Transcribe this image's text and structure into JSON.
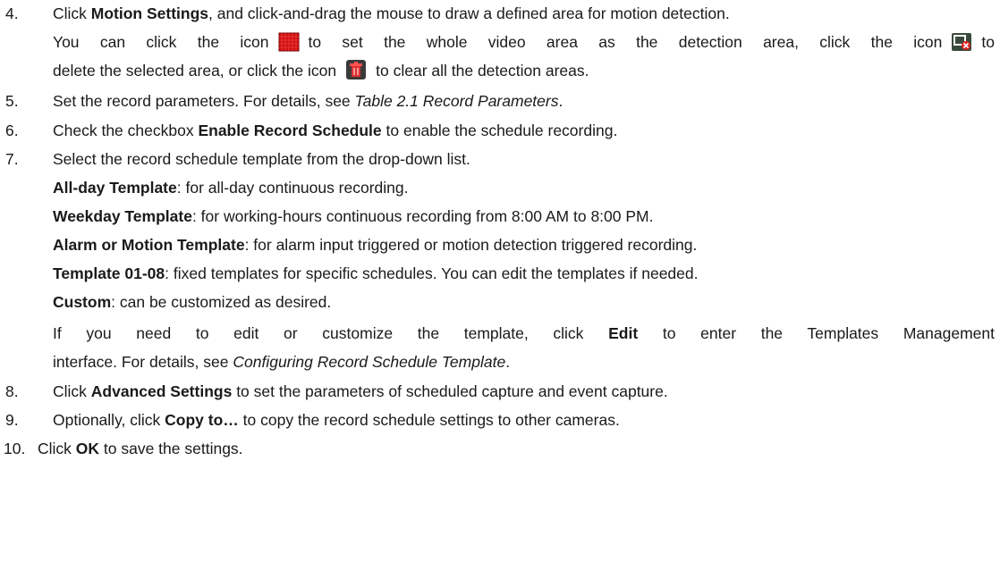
{
  "steps": {
    "s4": {
      "num": "4.",
      "a_pre": "Click ",
      "a_bold": "Motion Settings",
      "a_post": ", and click-and-drag the mouse to draw a defined area for motion detection.",
      "b_1": "You can click the icon",
      "b_2": "to set the whole video area as the detection area, click the icon",
      "b_3": "to",
      "c_1": "delete the selected area, or click the icon",
      "c_2": "to clear all the detection areas."
    },
    "s5": {
      "num": "5.",
      "pre": "Set the record parameters. For details, see ",
      "ital": "Table 2.1 Record Parameters",
      "post": "."
    },
    "s6": {
      "num": "6.",
      "pre": "Check the checkbox ",
      "bold": "Enable Record Schedule",
      "post": " to enable the schedule recording."
    },
    "s7": {
      "num": "7.",
      "intro": "Select the record schedule template from the drop-down list.",
      "options": [
        {
          "name": "All-day Template",
          "desc": ": for all-day continuous recording."
        },
        {
          "name": "Weekday Template",
          "desc": ": for working-hours continuous recording from 8:00 AM to 8:00 PM."
        },
        {
          "name": "Alarm or Motion Template",
          "desc": ": for alarm input triggered or motion detection triggered recording."
        },
        {
          "name": "Template 01-08",
          "desc": ": fixed templates for specific schedules. You can edit the templates if needed."
        },
        {
          "name": "Custom",
          "desc": ": can be customized as desired."
        }
      ],
      "edit_pre": "If you need to edit or customize the template, click",
      "edit_bold": "Edit",
      "edit_post": "to enter the Templates Management",
      "edit2_pre": "interface. For details, see ",
      "edit2_ital": "Configuring Record Schedule Template",
      "edit2_post": "."
    },
    "s8": {
      "num": "8.",
      "pre": "Click ",
      "bold": "Advanced Settings",
      "post": " to set the parameters of scheduled capture and event capture."
    },
    "s9": {
      "num": "9.",
      "pre": "Optionally, click ",
      "bold": "Copy to…",
      "post": " to copy the record schedule settings to other cameras."
    },
    "s10": {
      "num": "10.",
      "pre": "Click ",
      "bold": "OK",
      "post": " to save the settings."
    }
  },
  "icons": [
    "select-all-area-icon",
    "delete-area-icon",
    "clear-all-areas-icon"
  ],
  "colors": {
    "text": "#1a1a1a",
    "icon_red": "#d01010"
  }
}
